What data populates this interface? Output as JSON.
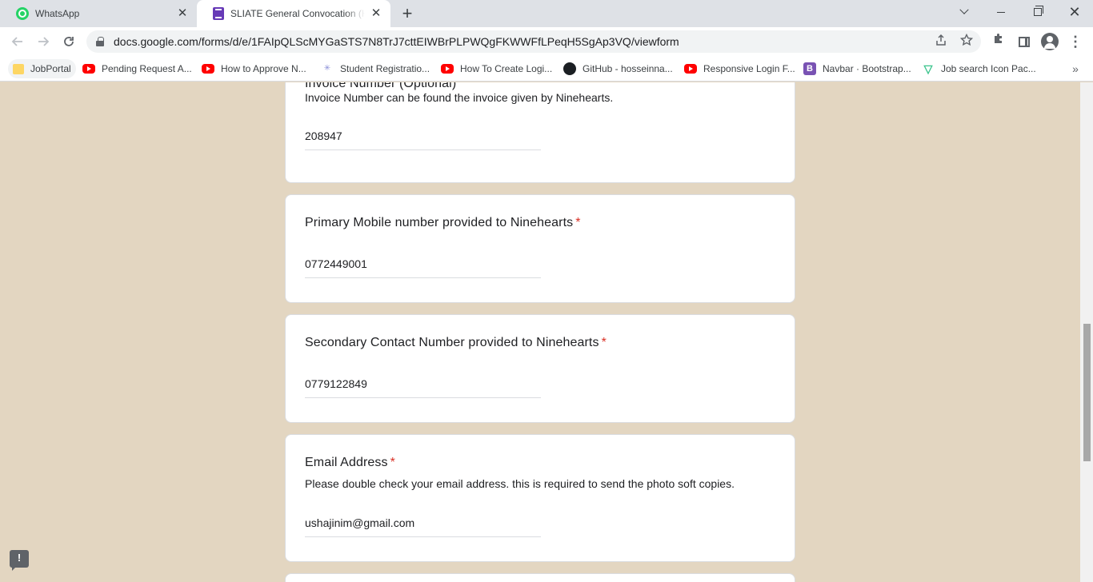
{
  "browser": {
    "tabs": [
      {
        "title": "WhatsApp",
        "icon": "whatsapp-icon",
        "active": false
      },
      {
        "title": "SLIATE General Convocation (Hel",
        "icon": "google-forms-icon",
        "active": true
      }
    ],
    "close_glyph": "✕",
    "new_tab_glyph": "+",
    "url": "docs.google.com/forms/d/e/1FAIpQLScMYGaSTS7N8TrJ7cttEIWBrPLPWQgFKWWFfLPeqH5SgAp3VQ/viewform",
    "window_close_glyph": "✕",
    "menu_glyph": "⋮",
    "bookmarks_more_glyph": "»"
  },
  "bookmarks": [
    {
      "label": "JobPortal",
      "icon": "folder-icon"
    },
    {
      "label": "Pending Request A...",
      "icon": "youtube-icon"
    },
    {
      "label": "How to Approve N...",
      "icon": "youtube-icon"
    },
    {
      "label": "Student Registratio...",
      "icon": "site-icon"
    },
    {
      "label": "How To Create Logi...",
      "icon": "youtube-icon"
    },
    {
      "label": "GitHub - hosseinna...",
      "icon": "github-icon"
    },
    {
      "label": "Responsive Login F...",
      "icon": "youtube-icon"
    },
    {
      "label": "Navbar · Bootstrap...",
      "icon": "bootstrap-icon"
    },
    {
      "label": "Job search Icon Pac...",
      "icon": "vuetify-icon"
    }
  ],
  "form": {
    "required_mark": "*",
    "questions": [
      {
        "title": "Invoice Number (Optional)",
        "description": "Invoice Number can be found the invoice given by Ninehearts.",
        "answer": "208947",
        "required": false
      },
      {
        "title": "Primary Mobile number provided to Ninehearts",
        "answer": "0772449001",
        "required": true
      },
      {
        "title": "Secondary Contact Number provided to Ninehearts",
        "answer": "0779122849",
        "required": true
      },
      {
        "title": "Email Address",
        "description": "Please double check your email address. this is required to send the photo soft copies.",
        "answer": "ushajinim@gmail.com",
        "required": true
      }
    ]
  },
  "feedback_glyph": "!",
  "colors": {
    "page_background": "#e3d6c1",
    "required": "#d93025",
    "forms_purple": "#673ab7"
  }
}
